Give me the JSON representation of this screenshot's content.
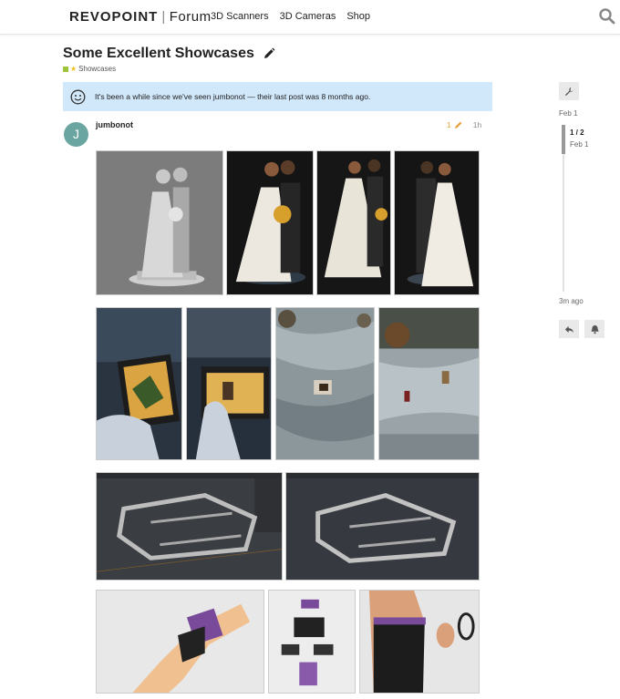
{
  "header": {
    "brand": "REVOPOINT",
    "separator": "|",
    "section": "Forum",
    "nav": [
      "3D Scanners",
      "3D Cameras",
      "Shop"
    ],
    "search_icon": "search-icon"
  },
  "topic": {
    "title": "Some Excellent Showcases",
    "category": "Showcases",
    "category_color": "#9ec53b"
  },
  "notice": {
    "text": "It's been a while since we've seen jumbonot — their last post was 8 months ago."
  },
  "post": {
    "avatar_letter": "J",
    "avatar_color": "#6aa5a1",
    "username": "jumbonot",
    "edit_count": "1",
    "age": "1h"
  },
  "timeline": {
    "start_date": "Feb 1",
    "position": "1 / 2",
    "position_date": "Feb 1",
    "end_label": "3m ago"
  }
}
